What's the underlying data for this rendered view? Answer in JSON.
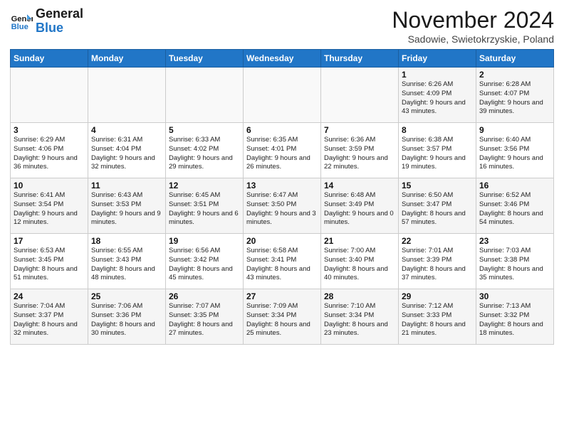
{
  "header": {
    "logo_general": "General",
    "logo_blue": "Blue",
    "month_title": "November 2024",
    "location": "Sadowie, Swietokrzyskie, Poland"
  },
  "weekdays": [
    "Sunday",
    "Monday",
    "Tuesday",
    "Wednesday",
    "Thursday",
    "Friday",
    "Saturday"
  ],
  "weeks": [
    [
      {
        "day": "",
        "info": ""
      },
      {
        "day": "",
        "info": ""
      },
      {
        "day": "",
        "info": ""
      },
      {
        "day": "",
        "info": ""
      },
      {
        "day": "",
        "info": ""
      },
      {
        "day": "1",
        "info": "Sunrise: 6:26 AM\nSunset: 4:09 PM\nDaylight: 9 hours and 43 minutes."
      },
      {
        "day": "2",
        "info": "Sunrise: 6:28 AM\nSunset: 4:07 PM\nDaylight: 9 hours and 39 minutes."
      }
    ],
    [
      {
        "day": "3",
        "info": "Sunrise: 6:29 AM\nSunset: 4:06 PM\nDaylight: 9 hours and 36 minutes."
      },
      {
        "day": "4",
        "info": "Sunrise: 6:31 AM\nSunset: 4:04 PM\nDaylight: 9 hours and 32 minutes."
      },
      {
        "day": "5",
        "info": "Sunrise: 6:33 AM\nSunset: 4:02 PM\nDaylight: 9 hours and 29 minutes."
      },
      {
        "day": "6",
        "info": "Sunrise: 6:35 AM\nSunset: 4:01 PM\nDaylight: 9 hours and 26 minutes."
      },
      {
        "day": "7",
        "info": "Sunrise: 6:36 AM\nSunset: 3:59 PM\nDaylight: 9 hours and 22 minutes."
      },
      {
        "day": "8",
        "info": "Sunrise: 6:38 AM\nSunset: 3:57 PM\nDaylight: 9 hours and 19 minutes."
      },
      {
        "day": "9",
        "info": "Sunrise: 6:40 AM\nSunset: 3:56 PM\nDaylight: 9 hours and 16 minutes."
      }
    ],
    [
      {
        "day": "10",
        "info": "Sunrise: 6:41 AM\nSunset: 3:54 PM\nDaylight: 9 hours and 12 minutes."
      },
      {
        "day": "11",
        "info": "Sunrise: 6:43 AM\nSunset: 3:53 PM\nDaylight: 9 hours and 9 minutes."
      },
      {
        "day": "12",
        "info": "Sunrise: 6:45 AM\nSunset: 3:51 PM\nDaylight: 9 hours and 6 minutes."
      },
      {
        "day": "13",
        "info": "Sunrise: 6:47 AM\nSunset: 3:50 PM\nDaylight: 9 hours and 3 minutes."
      },
      {
        "day": "14",
        "info": "Sunrise: 6:48 AM\nSunset: 3:49 PM\nDaylight: 9 hours and 0 minutes."
      },
      {
        "day": "15",
        "info": "Sunrise: 6:50 AM\nSunset: 3:47 PM\nDaylight: 8 hours and 57 minutes."
      },
      {
        "day": "16",
        "info": "Sunrise: 6:52 AM\nSunset: 3:46 PM\nDaylight: 8 hours and 54 minutes."
      }
    ],
    [
      {
        "day": "17",
        "info": "Sunrise: 6:53 AM\nSunset: 3:45 PM\nDaylight: 8 hours and 51 minutes."
      },
      {
        "day": "18",
        "info": "Sunrise: 6:55 AM\nSunset: 3:43 PM\nDaylight: 8 hours and 48 minutes."
      },
      {
        "day": "19",
        "info": "Sunrise: 6:56 AM\nSunset: 3:42 PM\nDaylight: 8 hours and 45 minutes."
      },
      {
        "day": "20",
        "info": "Sunrise: 6:58 AM\nSunset: 3:41 PM\nDaylight: 8 hours and 43 minutes."
      },
      {
        "day": "21",
        "info": "Sunrise: 7:00 AM\nSunset: 3:40 PM\nDaylight: 8 hours and 40 minutes."
      },
      {
        "day": "22",
        "info": "Sunrise: 7:01 AM\nSunset: 3:39 PM\nDaylight: 8 hours and 37 minutes."
      },
      {
        "day": "23",
        "info": "Sunrise: 7:03 AM\nSunset: 3:38 PM\nDaylight: 8 hours and 35 minutes."
      }
    ],
    [
      {
        "day": "24",
        "info": "Sunrise: 7:04 AM\nSunset: 3:37 PM\nDaylight: 8 hours and 32 minutes."
      },
      {
        "day": "25",
        "info": "Sunrise: 7:06 AM\nSunset: 3:36 PM\nDaylight: 8 hours and 30 minutes."
      },
      {
        "day": "26",
        "info": "Sunrise: 7:07 AM\nSunset: 3:35 PM\nDaylight: 8 hours and 27 minutes."
      },
      {
        "day": "27",
        "info": "Sunrise: 7:09 AM\nSunset: 3:34 PM\nDaylight: 8 hours and 25 minutes."
      },
      {
        "day": "28",
        "info": "Sunrise: 7:10 AM\nSunset: 3:34 PM\nDaylight: 8 hours and 23 minutes."
      },
      {
        "day": "29",
        "info": "Sunrise: 7:12 AM\nSunset: 3:33 PM\nDaylight: 8 hours and 21 minutes."
      },
      {
        "day": "30",
        "info": "Sunrise: 7:13 AM\nSunset: 3:32 PM\nDaylight: 8 hours and 18 minutes."
      }
    ]
  ]
}
